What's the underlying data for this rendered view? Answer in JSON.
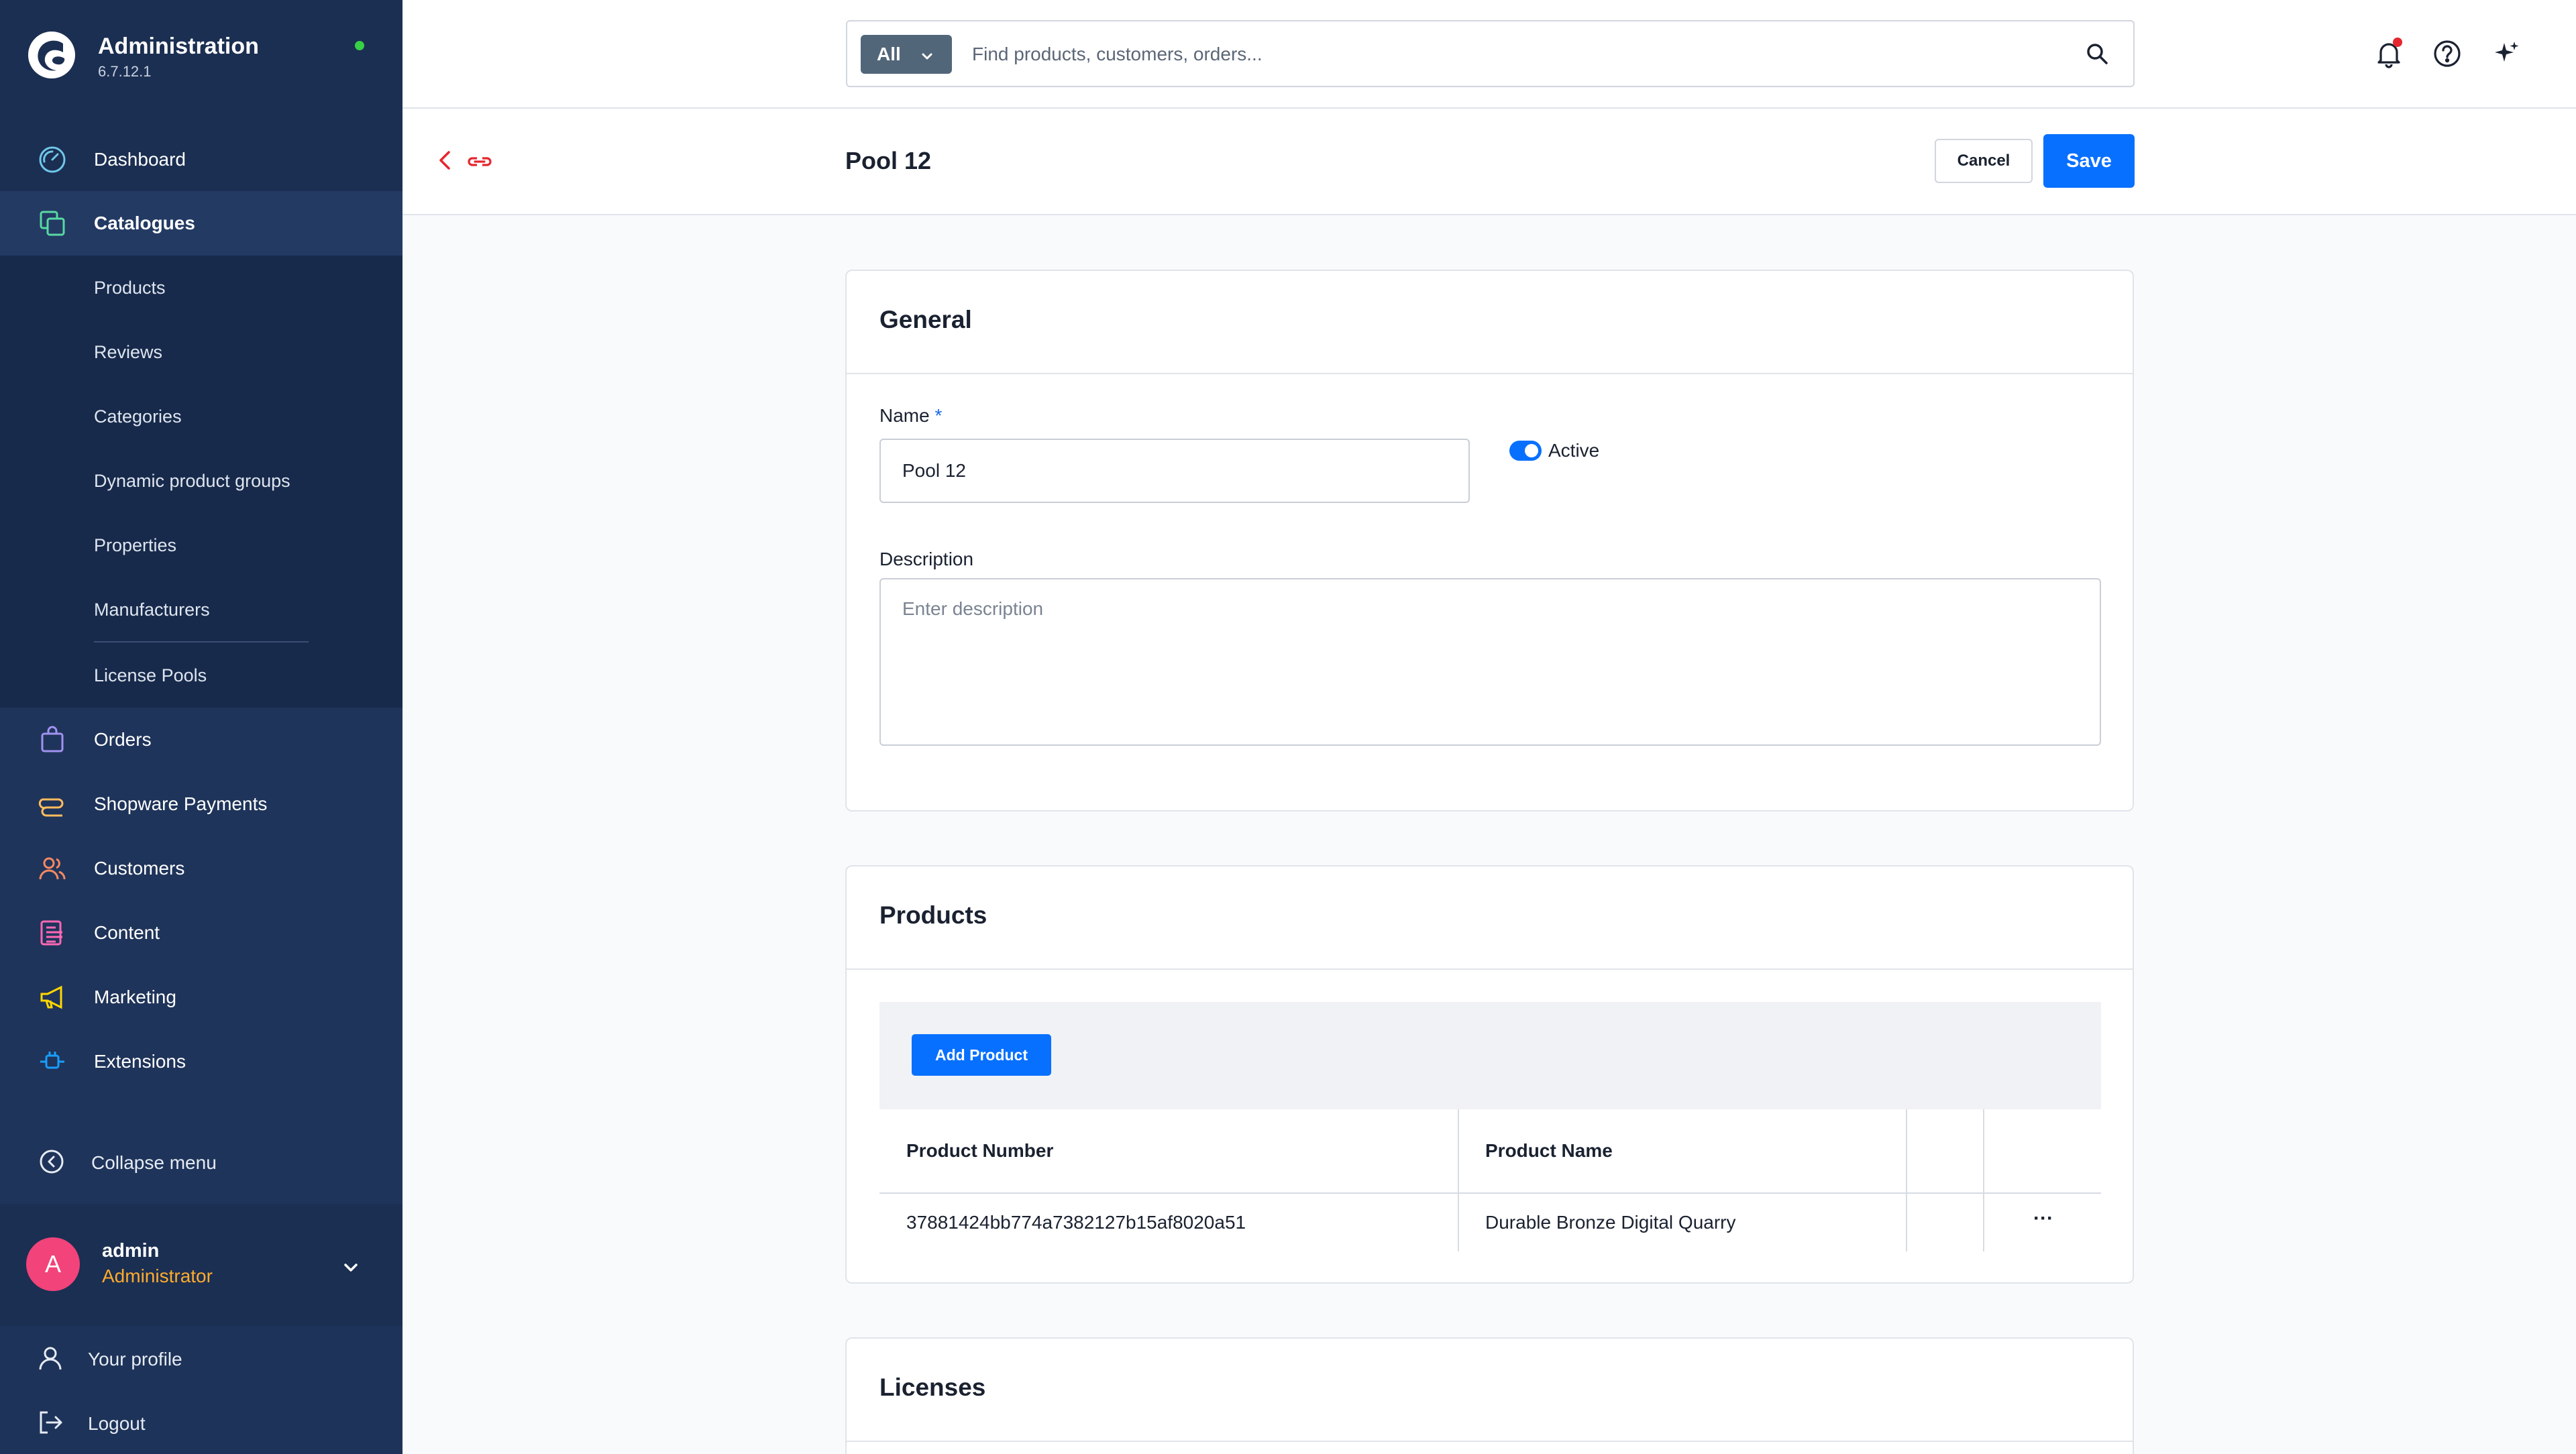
{
  "app": {
    "title": "Administration",
    "version": "6.7.12.1",
    "status_color": "#37d046"
  },
  "sidebar": {
    "main_items": [
      {
        "label": "Dashboard",
        "icon": "gauge-icon",
        "color": "#6fc7e8"
      },
      {
        "label": "Catalogues",
        "icon": "catalogue-icon",
        "color": "#57d9a3"
      }
    ],
    "catalogue_sub_items": [
      {
        "label": "Products"
      },
      {
        "label": "Reviews"
      },
      {
        "label": "Categories"
      },
      {
        "label": "Dynamic product groups"
      },
      {
        "label": "Properties"
      },
      {
        "label": "Manufacturers"
      },
      {
        "label": "License Pools"
      }
    ],
    "lower_items": [
      {
        "label": "Orders",
        "icon": "shopping-bag-icon",
        "color": "#a092f0"
      },
      {
        "label": "Shopware Payments",
        "icon": "payments-icon",
        "color": "#ffbd5d"
      },
      {
        "label": "Customers",
        "icon": "users-icon",
        "color": "#f88962"
      },
      {
        "label": "Content",
        "icon": "content-icon",
        "color": "#ff68b4"
      },
      {
        "label": "Marketing",
        "icon": "megaphone-icon",
        "color": "#ffd700"
      },
      {
        "label": "Extensions",
        "icon": "plug-icon",
        "color": "#189eff"
      }
    ],
    "collapse_label": "Collapse menu",
    "user": {
      "initial": "A",
      "name": "admin",
      "role": "Administrator"
    },
    "footer_items": [
      {
        "label": "Your profile",
        "icon": "user-icon"
      },
      {
        "label": "Logout",
        "icon": "logout-icon"
      }
    ]
  },
  "topbar": {
    "search_scope": "All",
    "search_placeholder": "Find products, customers, orders..."
  },
  "smartbar": {
    "title": "Pool 12",
    "cancel_label": "Cancel",
    "save_label": "Save"
  },
  "general": {
    "title": "General",
    "name_label": "Name",
    "required_mark": "*",
    "name_value": "Pool 12",
    "active_label": "Active",
    "active": true,
    "description_label": "Description",
    "description_placeholder": "Enter description"
  },
  "products": {
    "title": "Products",
    "add_label": "Add Product",
    "columns": [
      "Product Number",
      "Product Name"
    ],
    "rows": [
      {
        "number": "37881424bb774a7382127b15af8020a51",
        "name": "Durable Bronze Digital Quarry",
        "actions": "···"
      }
    ]
  },
  "licenses": {
    "title": "Licenses"
  },
  "colors": {
    "sidebar_bg": "#1b2f52",
    "primary": "#0870ff",
    "notification_dot": "#e5262e",
    "role": "#ffab2d",
    "avatar": "#f2437a"
  }
}
